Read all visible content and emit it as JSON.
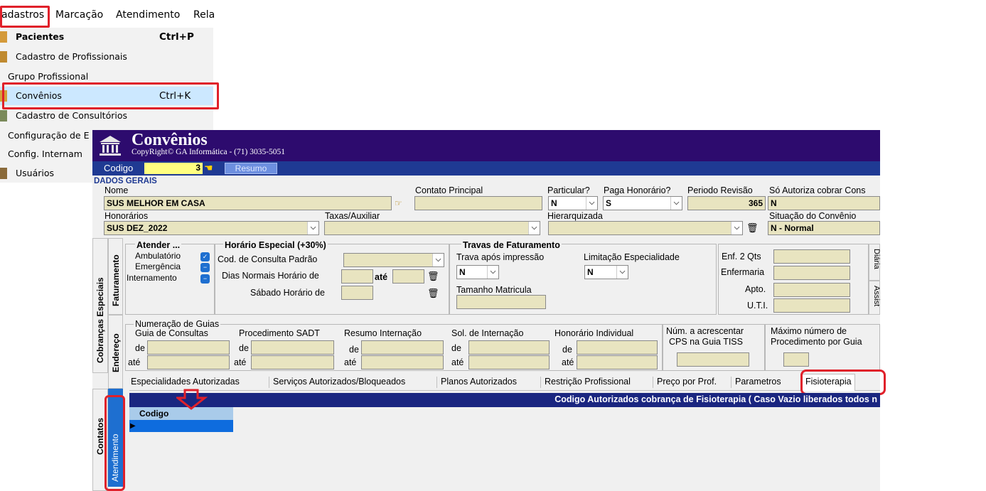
{
  "menu": {
    "items": [
      "adastros",
      "Marcação",
      "Atendimento",
      "Rela"
    ],
    "dropdown": [
      {
        "label": "Pacientes",
        "shortcut": "Ctrl+P",
        "bold": true
      },
      {
        "label": "Cadastro de Profissionais",
        "shortcut": ""
      },
      {
        "label": "Grupo Profissional",
        "shortcut": ""
      },
      {
        "label": "Convênios",
        "shortcut": "Ctrl+K"
      },
      {
        "label": "Cadastro de Consultórios",
        "shortcut": ""
      },
      {
        "label": "Configuração de E",
        "shortcut": ""
      },
      {
        "label": "Config. Internam",
        "shortcut": ""
      },
      {
        "label": "Usuários",
        "shortcut": ""
      }
    ]
  },
  "window": {
    "title": "Convênios",
    "copyright": "CopyRight© GA Informática - (71) 3035-5051",
    "codigo_label": "Codigo",
    "codigo_value": "3",
    "resumo_label": "Resumo",
    "section_title": "DADOS GERAIS"
  },
  "dados_gerais": {
    "nome_label": "Nome",
    "nome_value": "SUS MELHOR EM CASA",
    "contato_label": "Contato Principal",
    "particular_label": "Particular?",
    "particular_value": "N",
    "paga_label": "Paga Honorário?",
    "paga_value": "S",
    "periodo_label": "Periodo Revisão",
    "periodo_value": "365",
    "so_autoriza_label": "Só Autoriza cobrar Cons",
    "so_autoriza_value": "N",
    "honorarios_label": "Honorários",
    "honorarios_value": "SUS DEZ_2022",
    "taxas_label": "Taxas/Auxiliar",
    "hierarquizada_label": "Hierarquizada",
    "situacao_label": "Situação do Convênio",
    "situacao_value": "N - Normal"
  },
  "faturamento": {
    "atender_label": "Atender ...",
    "ambulatorio": "Ambulatório",
    "emergencia": "Emergência",
    "internamento": "Internamento",
    "horario_especial": "Horário Especial  (+30%)",
    "cod_consulta": "Cod. de Consulta Padrão",
    "dias_normais": "Dias Normais Horário de",
    "sabado": "Sábado Horário de",
    "ate": "até",
    "travas_title": "Travas de Faturamento",
    "trava_impressao": "Trava após impressão",
    "trava_value": "N",
    "limitacao": "Limitação Especialidade",
    "limitacao_value": "N",
    "tamanho_matricula": "Tamanho Matricula",
    "enf2": "Enf. 2 Qts",
    "enfermaria": "Enfermaria",
    "apto": "Apto.",
    "uti": "U.T.I.",
    "diaria": "Diária",
    "assist": "Assist"
  },
  "guias": {
    "title": "Numeração de Guias",
    "cols": [
      "Guia de Consultas",
      "Procedimento SADT",
      "Resumo Internação",
      "Sol. de Internação",
      "Honorário Individual"
    ],
    "de": "de",
    "ate": "até",
    "num_acrescentar": "Núm. a acrescentar",
    "cps": "CPS na Guia TISS",
    "maximo": "Máximo número de",
    "procedimento_por_guia": "Procedimento por Guia"
  },
  "side_tabs": {
    "cobrancas": "Cobranças Especiais",
    "faturamento": "Faturamento",
    "endereco": "Endereço",
    "contatos": "Contatos",
    "atendimento": "Atendimento"
  },
  "tabs": [
    "Especialidades Autorizadas",
    "Serviços Autorizados/Bloqueados",
    "Planos Autorizados",
    "Restrição Profissional",
    "Preço por Prof.",
    "Parametros",
    "Fisioterapia"
  ],
  "fisioterapia": {
    "banner": "Codigo Autorizados cobrança de Fisioterapia ( Caso Vazio liberados todos n",
    "grid_header": "Codigo"
  },
  "colors": {
    "title_bg": "#2d0b6e",
    "code_bar": "#1f3a93",
    "highlight": "#e0202a",
    "selected_menu": "#cce8ff"
  }
}
